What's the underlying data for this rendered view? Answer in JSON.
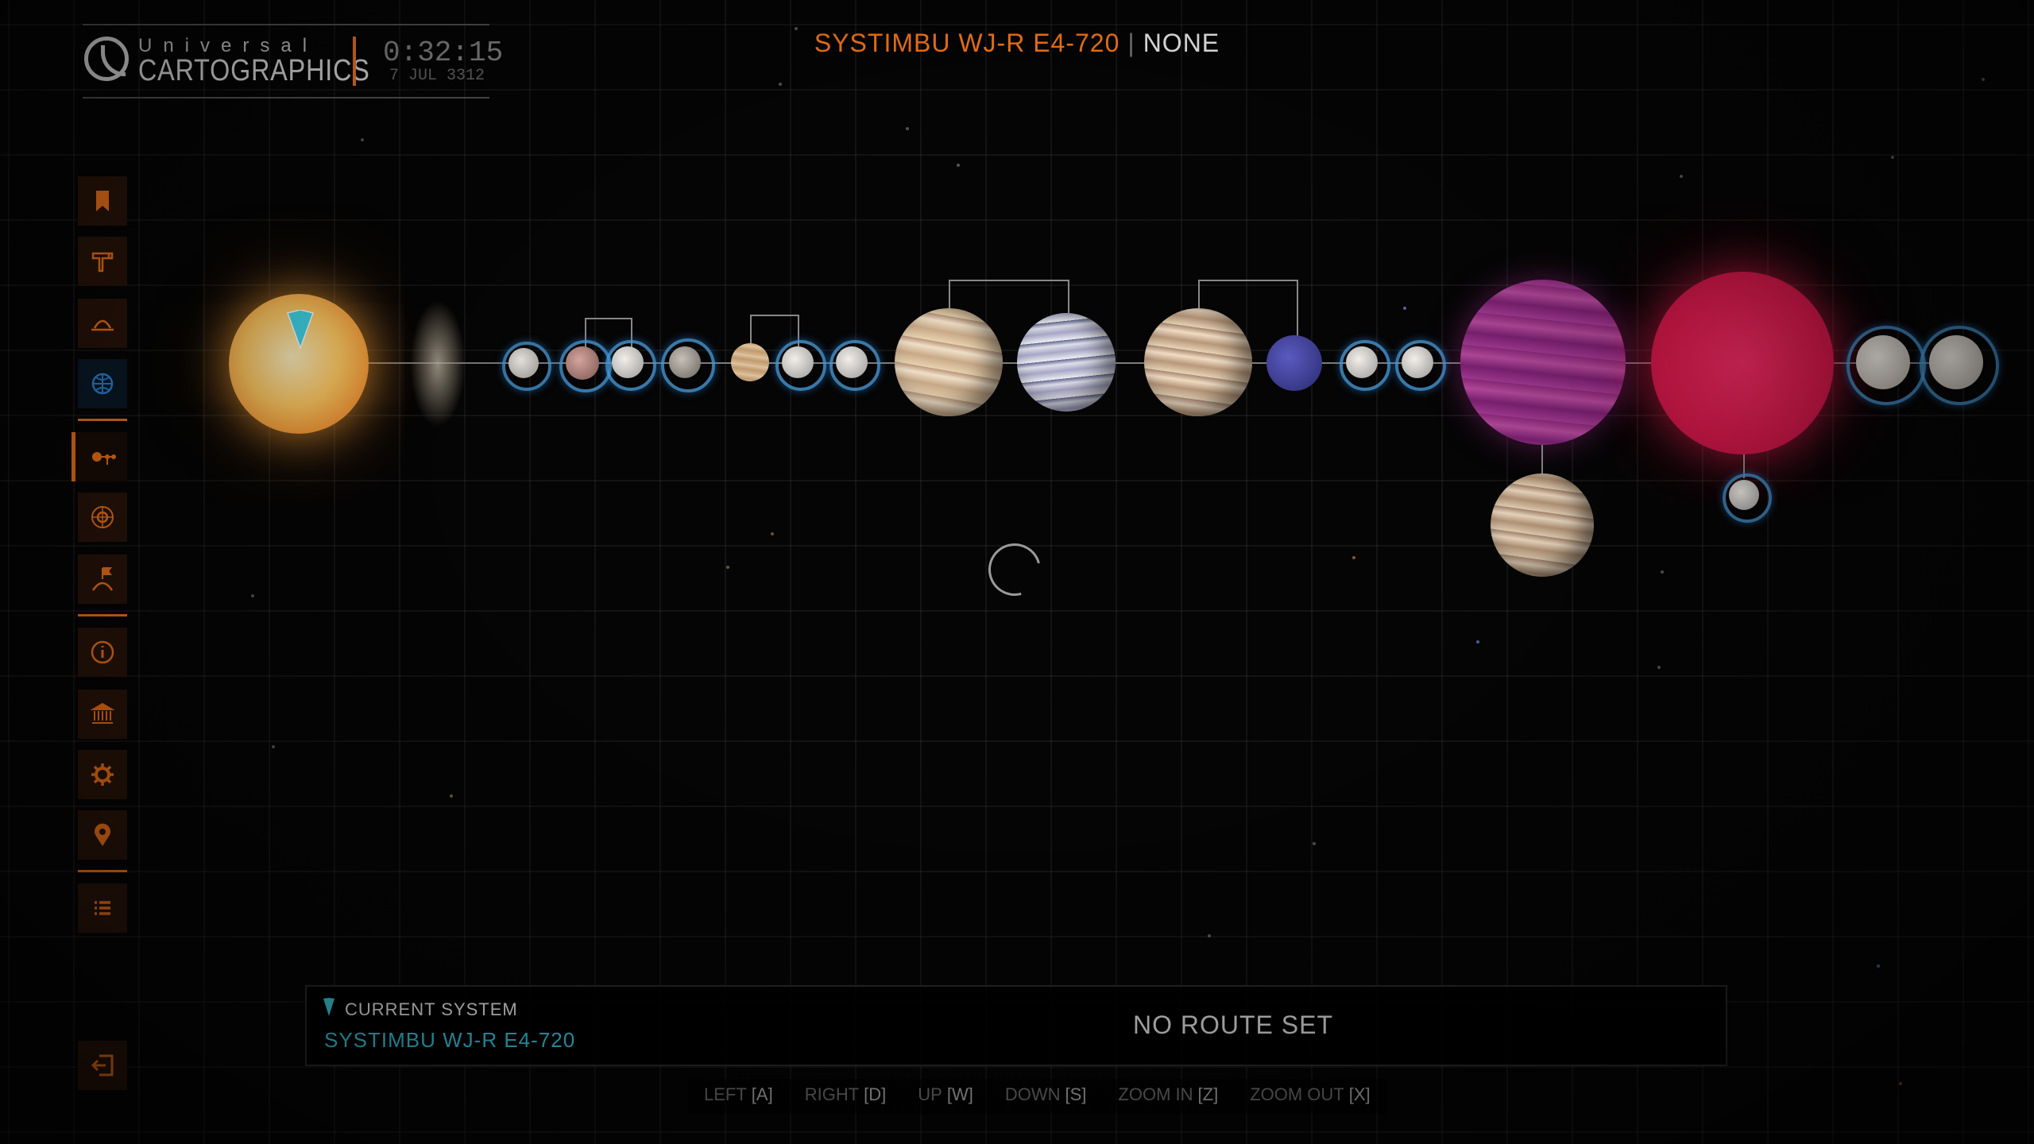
{
  "logo": {
    "small": "Universal",
    "big": "CARTOGRAPHICS",
    "time": "0:32:15",
    "date": "7 JUL 3312"
  },
  "header": {
    "system": "SYSTIMBU WJ-R E4-720",
    "separator": "|",
    "status": "NONE"
  },
  "sidebar": {
    "items": [
      {
        "name": "bookmark-icon"
      },
      {
        "name": "hammer-icon"
      },
      {
        "name": "landing-pad-icon",
        "count": "0"
      },
      {
        "name": "globe-icon",
        "count": "0"
      },
      {
        "name": "system-map-icon",
        "active": true
      },
      {
        "name": "planet-orbit-icon"
      },
      {
        "name": "flag-icon"
      },
      {
        "name": "info-icon"
      },
      {
        "name": "government-icon"
      },
      {
        "name": "gear-icon"
      },
      {
        "name": "location-pin-icon"
      },
      {
        "name": "list-icon"
      }
    ],
    "exit_icon": "exit-icon"
  },
  "route_panel": {
    "current_label": "CURRENT SYSTEM",
    "current_name": "SYSTIMBU WJ-R E4-720",
    "route_status": "NO ROUTE SET"
  },
  "keys": [
    {
      "action": "LEFT",
      "bind": "[A]"
    },
    {
      "action": "RIGHT",
      "bind": "[D]"
    },
    {
      "action": "UP",
      "bind": "[W]"
    },
    {
      "action": "DOWN",
      "bind": "[S]"
    },
    {
      "action": "ZOOM IN",
      "bind": "[Z]"
    },
    {
      "action": "ZOOM OUT",
      "bind": "[X]"
    }
  ],
  "colors": {
    "accent": "#ff7a1a",
    "current_system": "#3ad0e8",
    "selection_ring": "#4696d2"
  }
}
